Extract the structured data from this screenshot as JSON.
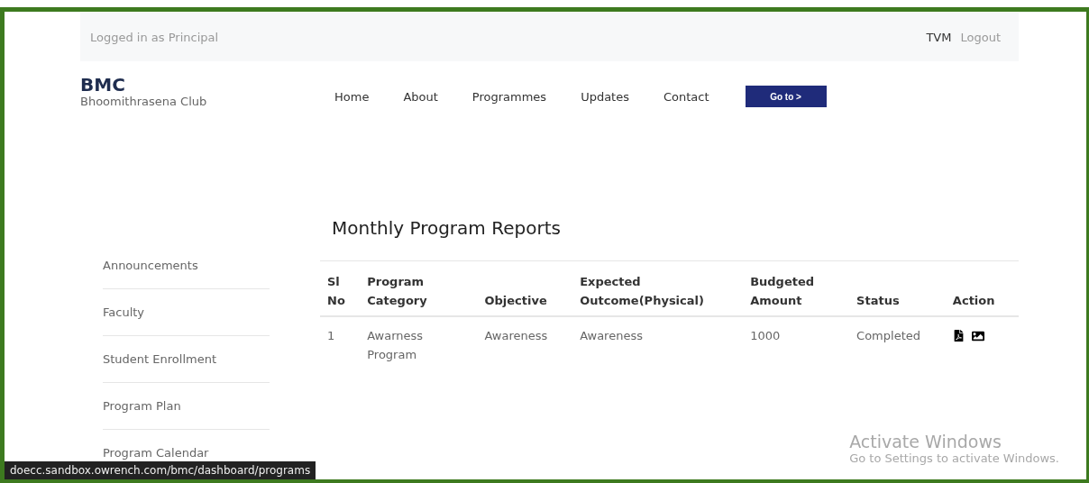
{
  "top_bar": {
    "login_text": "Logged in as Principal",
    "user": "TVM",
    "logout": "Logout"
  },
  "brand": {
    "title": "BMC",
    "subtitle": "Bhoomithrasena Club"
  },
  "nav": {
    "items": [
      "Home",
      "About",
      "Programmes",
      "Updates",
      "Contact"
    ],
    "button": "Go to >"
  },
  "sidebar": {
    "items": [
      "Announcements",
      "Faculty",
      "Student Enrollment",
      "Program Plan",
      "Program Calendar"
    ]
  },
  "page_title": "Monthly Program Reports",
  "table": {
    "columns": [
      "Sl No",
      "Program Category",
      "Objective",
      "Expected Outcome(Physical)",
      "Budgeted Amount",
      "Status",
      "Action"
    ],
    "rows": [
      {
        "cells": [
          "1",
          "Awarness Program",
          "Awareness",
          "Awareness",
          "1000",
          "Completed"
        ],
        "actions": [
          {
            "kind": "pdf"
          },
          {
            "kind": "image"
          }
        ]
      }
    ]
  },
  "os_overlay": {
    "title": "Activate Windows",
    "subtitle": "Go to Settings to activate Windows."
  },
  "status_bar": "doecc.sandbox.owrench.com/bmc/dashboard/programs"
}
